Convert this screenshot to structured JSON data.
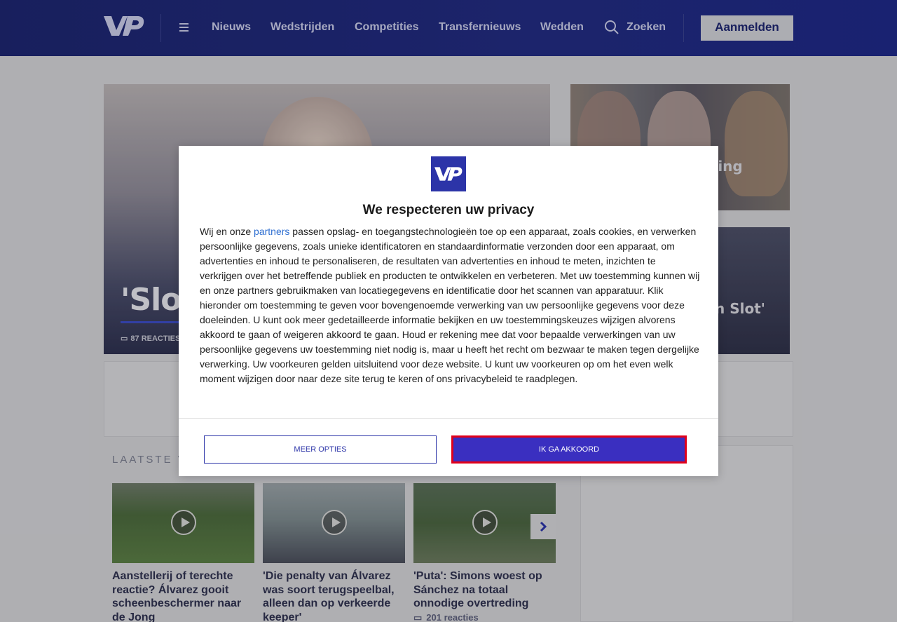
{
  "header": {
    "logo_text": "VP",
    "nav": [
      "Nieuws",
      "Wedstrijden",
      "Competities",
      "Transfernieuws",
      "Wedden"
    ],
    "search_label": "Zoeken",
    "login_label": "Aanmelden"
  },
  "hero": {
    "title": "'Slot",
    "comments": "87 REACTIES"
  },
  "side": {
    "item1_text": "ding",
    "item2_text": "n Slot'"
  },
  "latest": {
    "label": "LAATSTE VI",
    "cards": [
      {
        "title": "Aanstellerij of terechte reactie? Álvarez gooit scheenbeschermer naar de Jong",
        "comments": ""
      },
      {
        "title": "'Die penalty van Álvarez was soort terugspeelbal, alleen dan op verkeerde keeper'",
        "comments": ""
      },
      {
        "title": "'Puta': Simons woest op Sánchez na totaal onnodige overtreding",
        "comments": "201 reacties"
      }
    ]
  },
  "modal": {
    "logo_text": "VP",
    "title": "We respecteren uw privacy",
    "text_before_link": "Wij en onze ",
    "link_text": "partners",
    "text_after_link": " passen opslag- en toegangstechnologieën toe op een apparaat, zoals cookies, en verwerken persoonlijke gegevens, zoals unieke identificatoren en standaardinformatie verzonden door een apparaat, om advertenties en inhoud te personaliseren, de resultaten van advertenties en inhoud te meten, inzichten te verkrijgen over het betreffende publiek en producten te ontwikkelen en verbeteren. Met uw toestemming kunnen wij en onze partners gebruikmaken van locatiegegevens en identificatie door het scannen van apparatuur. Klik hieronder om toestemming te geven voor bovengenoemde verwerking van uw persoonlijke gegevens voor deze doeleinden. U kunt ook meer gedetailleerde informatie bekijken en uw toestemmingskeuzes wijzigen alvorens akkoord te gaan of weigeren akkoord te gaan. Houd er rekening mee dat voor bepaalde verwerkingen van uw persoonlijke gegevens uw toestemming niet nodig is, maar u heeft het recht om bezwaar te maken tegen dergelijke verwerking. Uw voorkeuren gelden uitsluitend voor deze website. U kunt uw voorkeuren op om het even welk moment wijzigen door naar deze site terug te keren of ons privacybeleid te raadplegen.",
    "more_options_label": "MEER OPTIES",
    "agree_label": "IK GA AKKOORD"
  },
  "colors": {
    "brand": "#222c82",
    "accent_button": "#3a2fc0",
    "highlight_border": "#e0001b",
    "link": "#2f6fd1"
  }
}
